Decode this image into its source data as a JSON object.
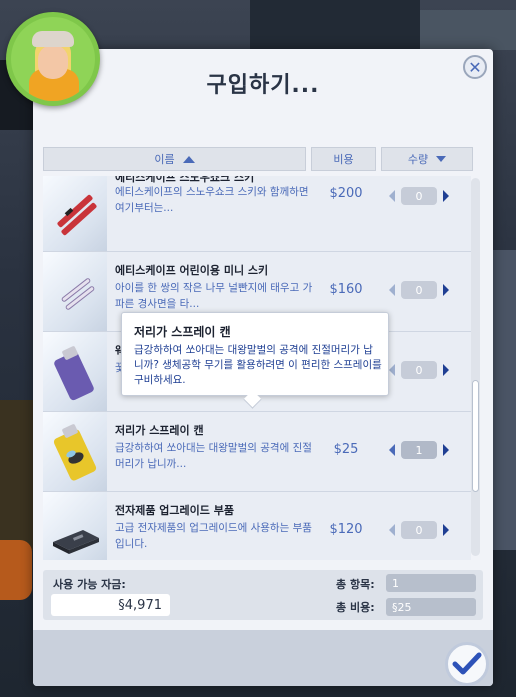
{
  "dialog": {
    "title": "구입하기..."
  },
  "columns": {
    "name": "이름",
    "cost": "비용",
    "qty": "수량"
  },
  "items": [
    {
      "name": "에티스케이프 스노우쇼크 스키",
      "desc": "에티스케이프의 스노우쇼크 스키와 함께하면 여기부터는...",
      "price": "$200",
      "qty": "0"
    },
    {
      "name": "에티스케이프 어린이용 미니 스키",
      "desc": "아이를 한 쌍의 작은 나무 널빤지에 태우고 가파른 경사면을 타...",
      "price": "$160",
      "qty": "0"
    },
    {
      "name": "웨",
      "desc": "꿏 적",
      "price": "",
      "qty": "0"
    },
    {
      "name": "저리가 스프레이 캔",
      "desc": "급강하하여 쏘아대는 대왕말벌의 공격에 진절머리가 납니까...",
      "price": "$25",
      "qty": "1"
    },
    {
      "name": "전자제품 업그레이드 부품",
      "desc": "고급 전자제품의 업그레이드에 사용하는 부품입니다.",
      "price": "$120",
      "qty": "0"
    }
  ],
  "tooltip": {
    "title": "저리가 스프레이 캔",
    "desc": "급강하하여 쏘아대는 대왕말벌의 공격에 진절머리가 납니까? 생체공학 무기를 활용하려면 이 편리한 스프레이를 구비하세요."
  },
  "footer": {
    "funds_label": "사용 가능 자금:",
    "funds_value": "§4,971",
    "total_items_label": "총 항목:",
    "total_items_value": "1",
    "total_cost_label": "총 비용:",
    "total_cost_value": "§25"
  },
  "icons": {
    "close": "close-icon",
    "confirm": "checkmark-icon",
    "sort": "sort-ascending-icon"
  },
  "colors": {
    "accent": "#4a6ab8",
    "dark_blue": "#1f3f93",
    "avatar_bg": "#7fc74a"
  }
}
